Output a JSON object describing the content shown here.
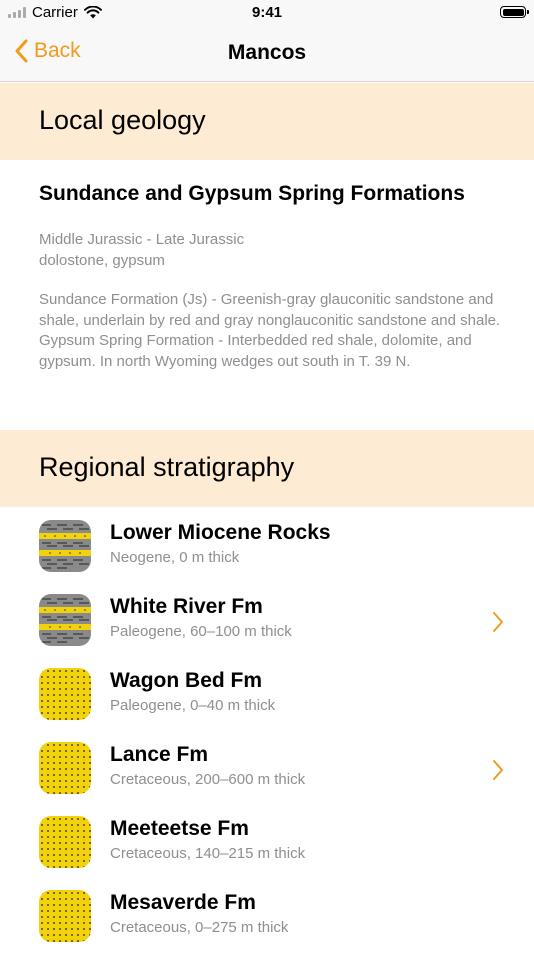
{
  "status_bar": {
    "carrier": "Carrier",
    "time": "9:41"
  },
  "nav": {
    "back_label": "Back",
    "title": "Mancos"
  },
  "local_geology": {
    "header": "Local geology",
    "formation": "Sundance and Gypsum Spring Formations",
    "age": "Middle Jurassic - Late Jurassic",
    "lithology": "dolostone, gypsum",
    "description": "Sundance Formation (Js) - Greenish-gray glauconitic sandstone and shale, underlain by red and gray nonglauconitic sandstone and shale.  Gypsum Spring Formation - Interbedded red shale, dolomite, and gypsum.  In north Wyoming wedges out south in T. 39 N."
  },
  "regional_stratigraphy": {
    "header": "Regional stratigraphy",
    "items": [
      {
        "name": "Lower Miocene Rocks",
        "detail": "Neogene, 0 m thick",
        "pattern": "striped-shale-sand",
        "has_chevron": false
      },
      {
        "name": "White River Fm",
        "detail": "Paleogene, 60–100 m thick",
        "pattern": "striped-shale-sand",
        "has_chevron": true
      },
      {
        "name": "Wagon Bed Fm",
        "detail": "Paleogene, 0–40 m thick",
        "pattern": "dotted-sand",
        "has_chevron": false
      },
      {
        "name": "Lance Fm",
        "detail": "Cretaceous, 200–600 m thick",
        "pattern": "dotted-sand",
        "has_chevron": true
      },
      {
        "name": "Meeteetse Fm",
        "detail": "Cretaceous, 140–215 m thick",
        "pattern": "dotted-sand",
        "has_chevron": false
      },
      {
        "name": "Mesaverde Fm",
        "detail": "Cretaceous, 0–275 m thick",
        "pattern": "dotted-sand",
        "has_chevron": false
      }
    ]
  },
  "colors": {
    "accent": "#f09a1e",
    "section_bg": "#fdebd3",
    "secondary_text": "#8e8e93"
  }
}
